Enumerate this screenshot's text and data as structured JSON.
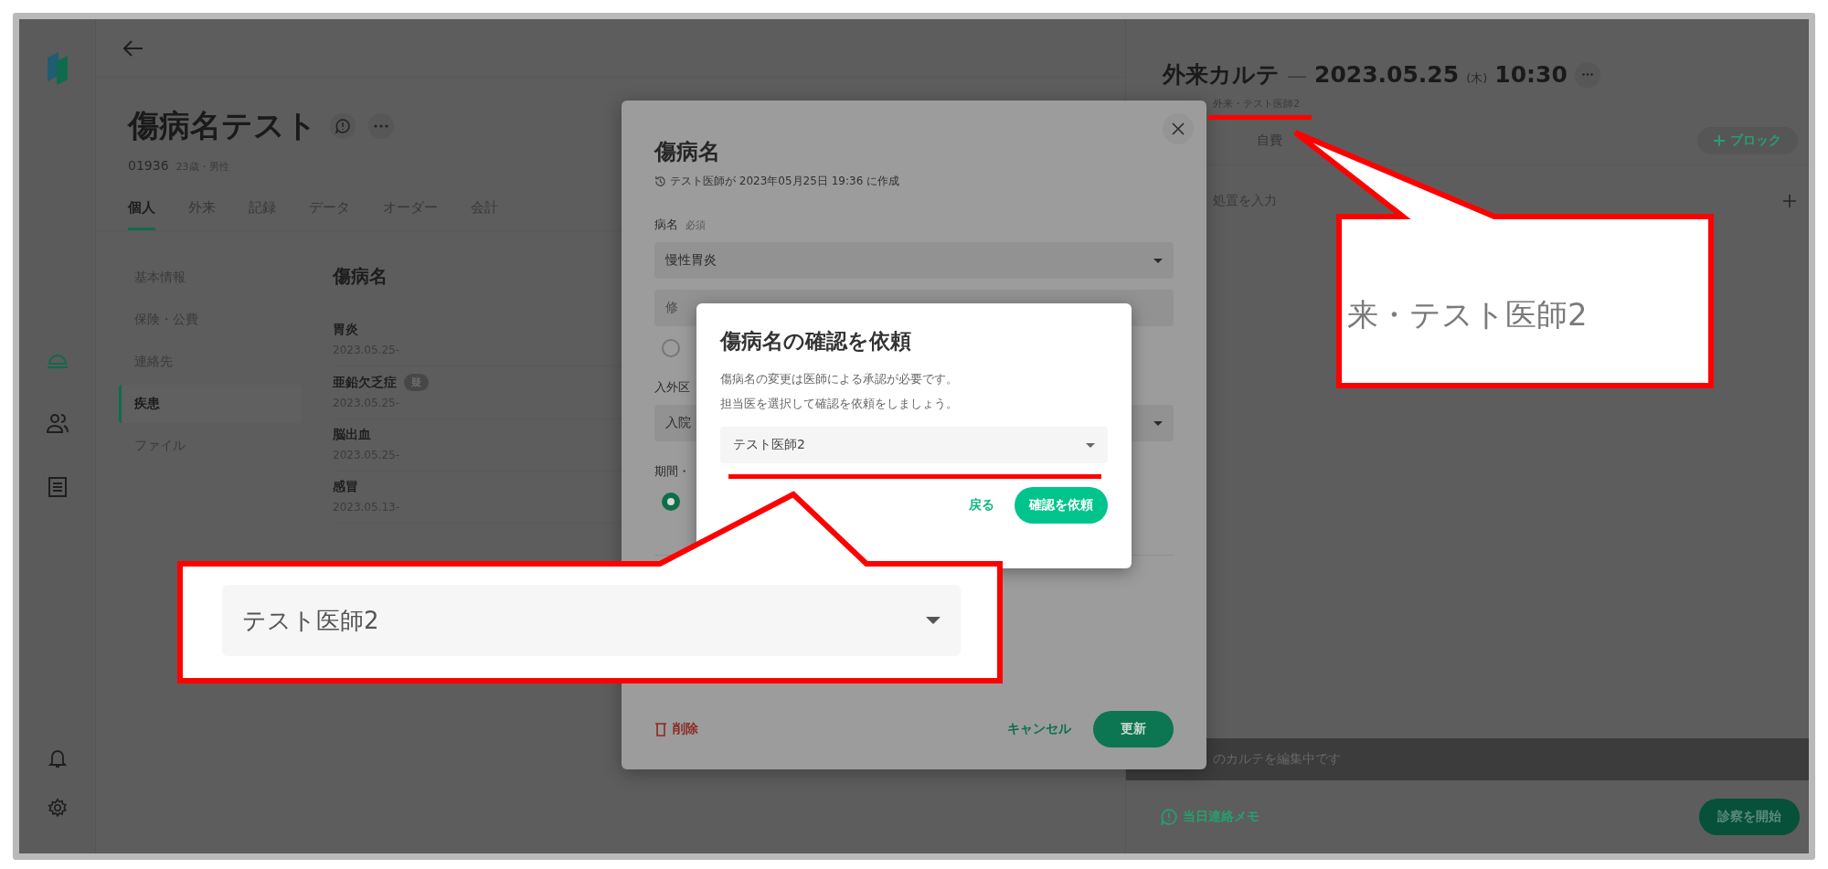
{
  "nav_rail": {
    "items": [
      {
        "kind": "home",
        "selected": true
      },
      {
        "kind": "people",
        "selected": false
      },
      {
        "kind": "list",
        "selected": false
      }
    ],
    "bottom": [
      {
        "kind": "bell"
      },
      {
        "kind": "gear"
      }
    ]
  },
  "patient": {
    "name": "傷病名テスト",
    "id": "01936",
    "meta": "23歳・男性"
  },
  "tabs": [
    {
      "label": "個人",
      "selected": true
    },
    {
      "label": "外来",
      "selected": false
    },
    {
      "label": "記録",
      "selected": false
    },
    {
      "label": "データ",
      "selected": false
    },
    {
      "label": "オーダー",
      "selected": false
    },
    {
      "label": "会計",
      "selected": false
    }
  ],
  "side_menu": [
    {
      "label": "基本情報",
      "selected": false
    },
    {
      "label": "保険・公費",
      "selected": false
    },
    {
      "label": "連絡先",
      "selected": false
    },
    {
      "label": "疾患",
      "selected": true
    },
    {
      "label": "ファイル",
      "selected": false
    }
  ],
  "diseases": {
    "title": "傷病名",
    "items": [
      {
        "name": "胃炎",
        "date": "2023.05.25-"
      },
      {
        "name": "亜鉛欠乏症",
        "badge": "疑",
        "date": "2023.05.25-"
      },
      {
        "name": "脳出血",
        "date": "2023.05.25-"
      },
      {
        "name": "感冒",
        "date": "2023.05.13-"
      }
    ]
  },
  "chart_panel": {
    "title": "外来カルテ",
    "dash": "—",
    "date": "2023.05.25",
    "weekday": "(木)",
    "time": "10:30",
    "subtitle": "外来・テスト医師2",
    "tab": "自費",
    "block_button": "ブロック",
    "input_placeholder": "処置を入力",
    "notice": "のカルテを編集中です",
    "memo_link": "当日連絡メモ",
    "start_button": "診察を開始"
  },
  "edit_dialog": {
    "title": "傷病名",
    "history": "テスト医師が 2023年05月25日 19:36 に作成",
    "name_label": "病名",
    "required": "必須",
    "name_value": "慢性胃炎",
    "modifier_placeholder": "修",
    "primary_checked": false,
    "type_label": "入外区",
    "type_value": "入院",
    "period_label": "期間・",
    "period_checked": true,
    "delete_button": "削除",
    "cancel_button": "キャンセル",
    "update_button": "更新"
  },
  "confirm_dialog": {
    "title": "傷病名の確認を依頼",
    "lines": [
      "傷病名の変更は医師による承認が必要です。",
      "担当医を選択して確認を依頼をしましょう。"
    ],
    "doctor": "テスト医師2",
    "back_button": "戻る",
    "request_button": "確認を依頼"
  },
  "callouts": [
    {
      "kind": "select",
      "text": "テスト医師2"
    },
    {
      "kind": "text",
      "text": "来・テスト医師2"
    }
  ]
}
